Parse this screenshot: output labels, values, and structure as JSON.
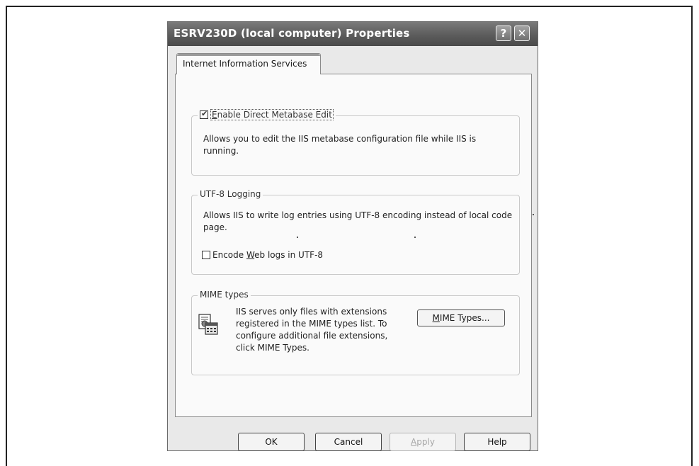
{
  "dialog": {
    "title": "ESRV230D (local computer) Properties",
    "help_glyph": "?",
    "close_glyph": "✕"
  },
  "tabs": [
    {
      "label": "Internet Information Services",
      "active": true
    }
  ],
  "metabase": {
    "checkbox_checked": true,
    "checkbox_label_mnemonic": "E",
    "checkbox_label_rest": "nable Direct Metabase Edit",
    "description": "Allows you to edit the IIS metabase configuration file while IIS is running."
  },
  "utf8": {
    "group_title": "UTF-8 Logging",
    "description": "Allows IIS to write log entries using UTF-8 encoding instead of local code page.",
    "checkbox_checked": false,
    "checkbox_label_before": "Encode ",
    "checkbox_label_mnemonic": "W",
    "checkbox_label_after": "eb logs in UTF-8"
  },
  "mime": {
    "group_title": "MIME types",
    "icon": "mime-types-icon",
    "description": "IIS serves only files with extensions registered in the MIME types list. To configure additional file extensions, click MIME Types.",
    "button_mnemonic": "M",
    "button_rest": "IME Types..."
  },
  "buttons": {
    "ok": "OK",
    "cancel": "Cancel",
    "apply_mnemonic": "A",
    "apply_rest": "pply",
    "help": "Help"
  }
}
